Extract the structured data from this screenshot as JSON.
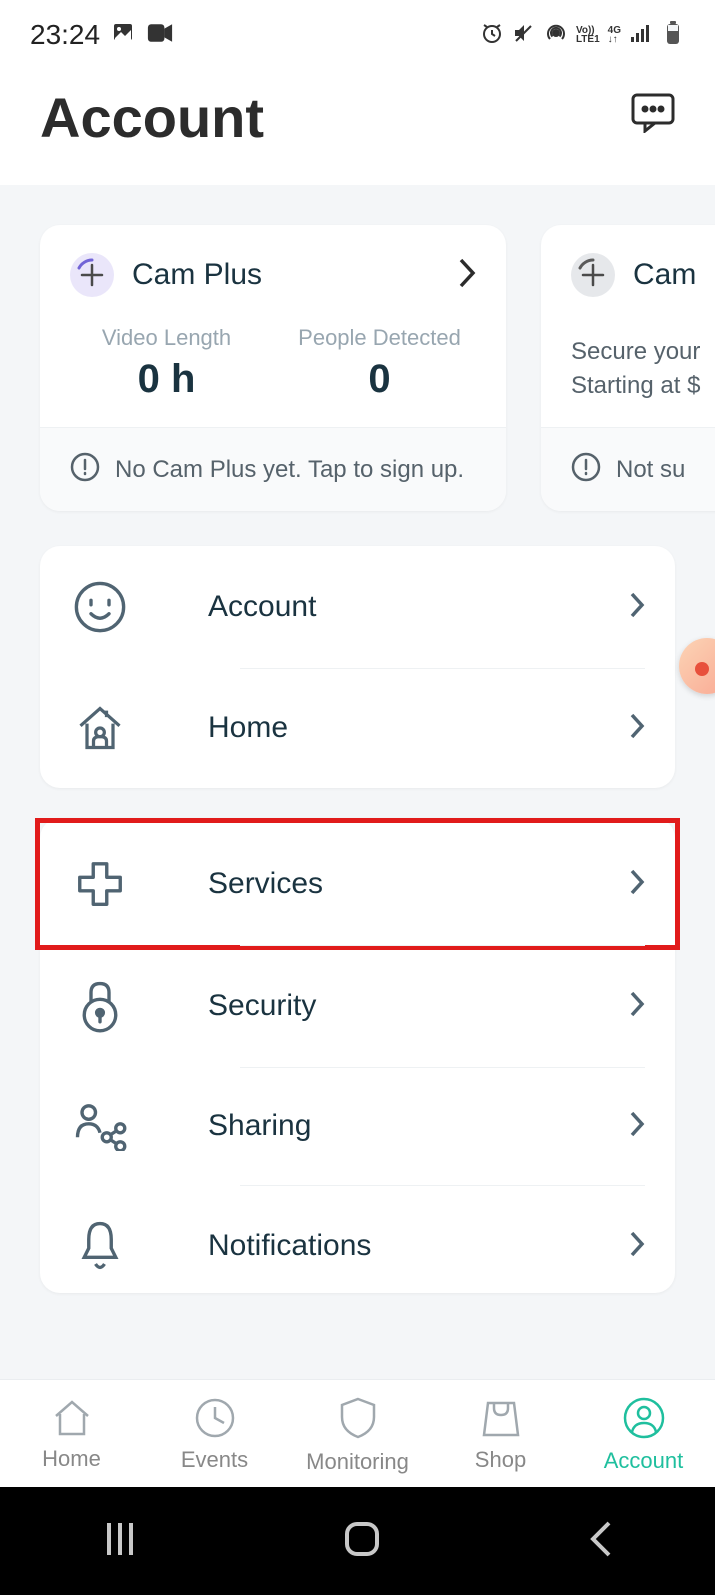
{
  "status": {
    "time": "23:24"
  },
  "header": {
    "title": "Account"
  },
  "cards": {
    "camPlus": {
      "title": "Cam Plus",
      "videoLengthLabel": "Video Length",
      "videoLengthValue": "0 h",
      "peopleDetectedLabel": "People Detected",
      "peopleDetectedValue": "0",
      "footerText": "No Cam Plus yet. Tap to sign up."
    },
    "secondary": {
      "title": "Cam",
      "descLine1": "Secure your",
      "descLine2": "Starting at $",
      "footerText": "Not su"
    }
  },
  "menu": {
    "account": "Account",
    "home": "Home",
    "services": "Services",
    "security": "Security",
    "sharing": "Sharing",
    "notifications": "Notifications"
  },
  "tabs": {
    "home": "Home",
    "events": "Events",
    "monitoring": "Monitoring",
    "shop": "Shop",
    "account": "Account"
  }
}
